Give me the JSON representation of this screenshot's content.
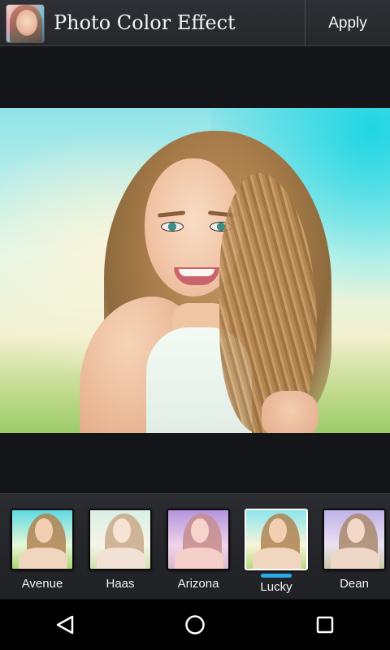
{
  "header": {
    "app_icon": "app-portrait-icon",
    "title": "Photo Color Effect",
    "apply_label": "Apply"
  },
  "photo": {
    "subject": "portrait-photo"
  },
  "filters": [
    {
      "label": "Avenue",
      "tint": "#7fe0e6",
      "selected": false
    },
    {
      "label": "Haas",
      "tint": "#e9f4df",
      "selected": false
    },
    {
      "label": "Arizona",
      "tint": "#c9a3dc",
      "selected": false
    },
    {
      "label": "Lucky",
      "tint": "#b7eef2",
      "selected": true
    },
    {
      "label": "Dean",
      "tint": "#d0c3ea",
      "selected": false
    }
  ],
  "colors": {
    "selection_accent": "#2aa9e4",
    "topbar": "#2b2d31",
    "background": "#141518"
  },
  "navbar": {
    "back_icon": "back-icon",
    "home_icon": "home-icon",
    "recents_icon": "recents-icon"
  }
}
